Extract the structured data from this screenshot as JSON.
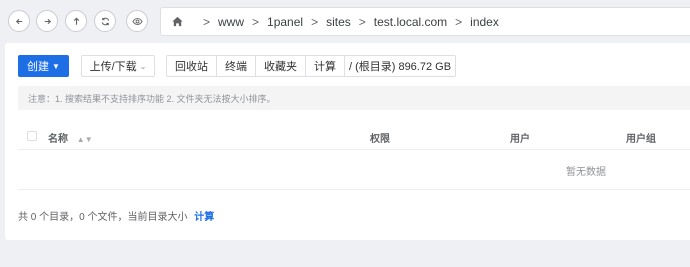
{
  "nav": {
    "icons": [
      "arrow-left-icon",
      "arrow-right-icon",
      "arrow-up-icon",
      "refresh-icon",
      "eye-icon",
      "home-icon"
    ],
    "breadcrumb": [
      ">",
      "www",
      ">",
      "1panel",
      ">",
      "sites",
      ">",
      "test.local.com",
      ">",
      "index"
    ]
  },
  "toolbar": {
    "create_label": "创建",
    "upload_label": "上传/下载",
    "recycle_label": "回收站",
    "terminal_label": "终端",
    "favorites_label": "收藏夹",
    "calculate_label": "计算",
    "disk_label": "/ (根目录) 896.72 GB"
  },
  "notice": "注意：1. 搜索结果不支持排序功能 2. 文件夹无法按大小排序。",
  "table": {
    "headers": [
      "名称",
      "权限",
      "用户",
      "用户组"
    ],
    "empty_text": "暂无数据"
  },
  "footer": {
    "summary": "共 0 个目录，0 个文件，当前目录大小",
    "calculate_link": "计算"
  },
  "colors": {
    "primary": "#1e6fe6",
    "background": "#eef0f3"
  }
}
